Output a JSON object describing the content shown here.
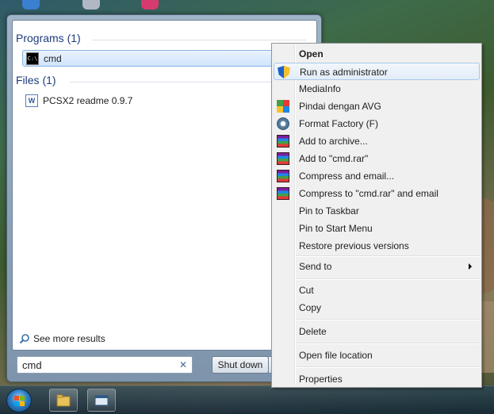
{
  "start_menu": {
    "programs_header": "Programs (1)",
    "programs": [
      {
        "label": "cmd",
        "icon": "cmd-icon"
      }
    ],
    "files_header": "Files (1)",
    "files": [
      {
        "label": "PCSX2 readme 0.9.7",
        "icon": "word-document-icon"
      }
    ],
    "see_more": "See more results",
    "search_value": "cmd",
    "clear_symbol": "✕",
    "shutdown_label": "Shut down"
  },
  "context_menu": {
    "items": [
      {
        "label": "Open",
        "bold": true
      },
      {
        "label": "Run as administrator",
        "icon": "uac-shield-icon"
      },
      {
        "label": "MediaInfo"
      },
      {
        "label": "Pindai dengan AVG",
        "icon": "avg-icon"
      },
      {
        "label": "Format Factory (F)",
        "icon": "format-factory-icon"
      },
      {
        "label": "Add to archive...",
        "icon": "winrar-icon"
      },
      {
        "label": "Add to \"cmd.rar\"",
        "icon": "winrar-icon"
      },
      {
        "label": "Compress and email...",
        "icon": "winrar-icon"
      },
      {
        "label": "Compress to \"cmd.rar\" and email",
        "icon": "winrar-icon"
      },
      {
        "label": "Pin to Taskbar"
      },
      {
        "label": "Pin to Start Menu"
      },
      {
        "label": "Restore previous versions"
      },
      {
        "label": "Send to"
      },
      {
        "label": "Cut"
      },
      {
        "label": "Copy"
      },
      {
        "label": "Delete"
      },
      {
        "label": "Open file location"
      },
      {
        "label": "Properties"
      }
    ]
  },
  "colors": {
    "header_blue": "#1e3c7b",
    "selection": "#cfe4fb",
    "menu_bg": "#f0f0f0"
  }
}
